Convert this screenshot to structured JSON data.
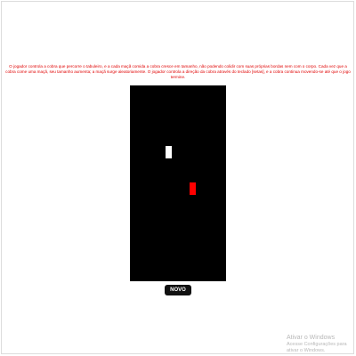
{
  "instructions": {
    "text": "O jogador controla a cobra que percorre o tabuleiro, e a cada maçã comida a cobra cresce em tamanho, não podendo colidir com suas próprias bordas nem com o corpo. Cada vez que a cobra come uma maçã, seu tamanho aumenta; a maçã surge aleatoriamente. O jogador controla a direção da cobra através do teclado [setas], e a cobra continua movendo-se até que o jogo termine.",
    "color": "#e00000"
  },
  "board": {
    "background": "#000000",
    "snake_color": "#ffffff",
    "food_color": "#ff0000"
  },
  "new_game_button": {
    "label": "NOVO JOGO"
  },
  "watermark": {
    "title": "Ativar o Windows",
    "subtitle": "Acesse Configurações para ativar o Windows."
  }
}
